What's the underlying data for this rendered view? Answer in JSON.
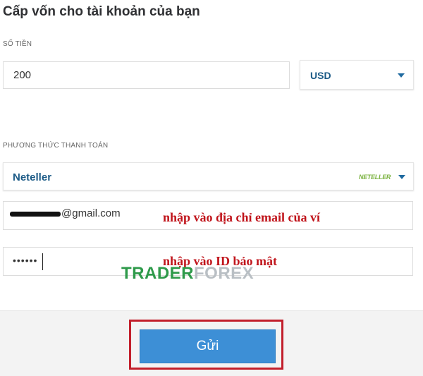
{
  "page": {
    "title": "Cấp vốn cho tài khoản của bạn"
  },
  "amount": {
    "label": "SỐ TIỀN",
    "value": "200"
  },
  "currency": {
    "selected": "USD"
  },
  "payment": {
    "label": "PHƯƠNG THỨC THANH TOÁN",
    "method": "Neteller",
    "brand": "NETELLER"
  },
  "email": {
    "value": "@gmail.com",
    "annotation": "nhập vào địa chỉ email của ví"
  },
  "pin": {
    "value": "••••••",
    "annotation": "nhập vào ID bảo mật"
  },
  "watermark": {
    "part1": "TRADER",
    "part2": "FOREX"
  },
  "submit": {
    "label": "Gửi"
  },
  "colors": {
    "accent": "#3d8fd6",
    "highlight": "#c21f2b",
    "annotation": "#c0141b",
    "brand_green": "#7cb342"
  }
}
